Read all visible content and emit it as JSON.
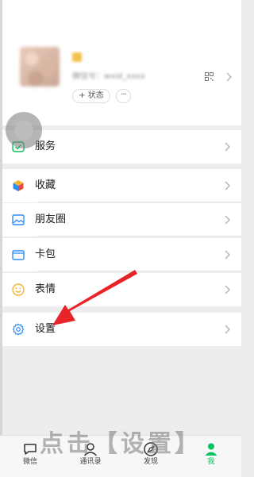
{
  "profile": {
    "wechat_id": "微信号：wxid_xxxx",
    "status_label": "+ 状态",
    "more_label": "···"
  },
  "menu": {
    "services": "服务",
    "favorites": "收藏",
    "moments": "朋友圈",
    "cards": "卡包",
    "stickers": "表情",
    "settings": "设置"
  },
  "tabbar": {
    "chats": "微信",
    "contacts": "通讯录",
    "discover": "发现",
    "me": "我"
  },
  "annotation": {
    "caption": "点击【设置】"
  },
  "colors": {
    "accent_green": "#07c160",
    "arrow_red": "#e8232a"
  }
}
